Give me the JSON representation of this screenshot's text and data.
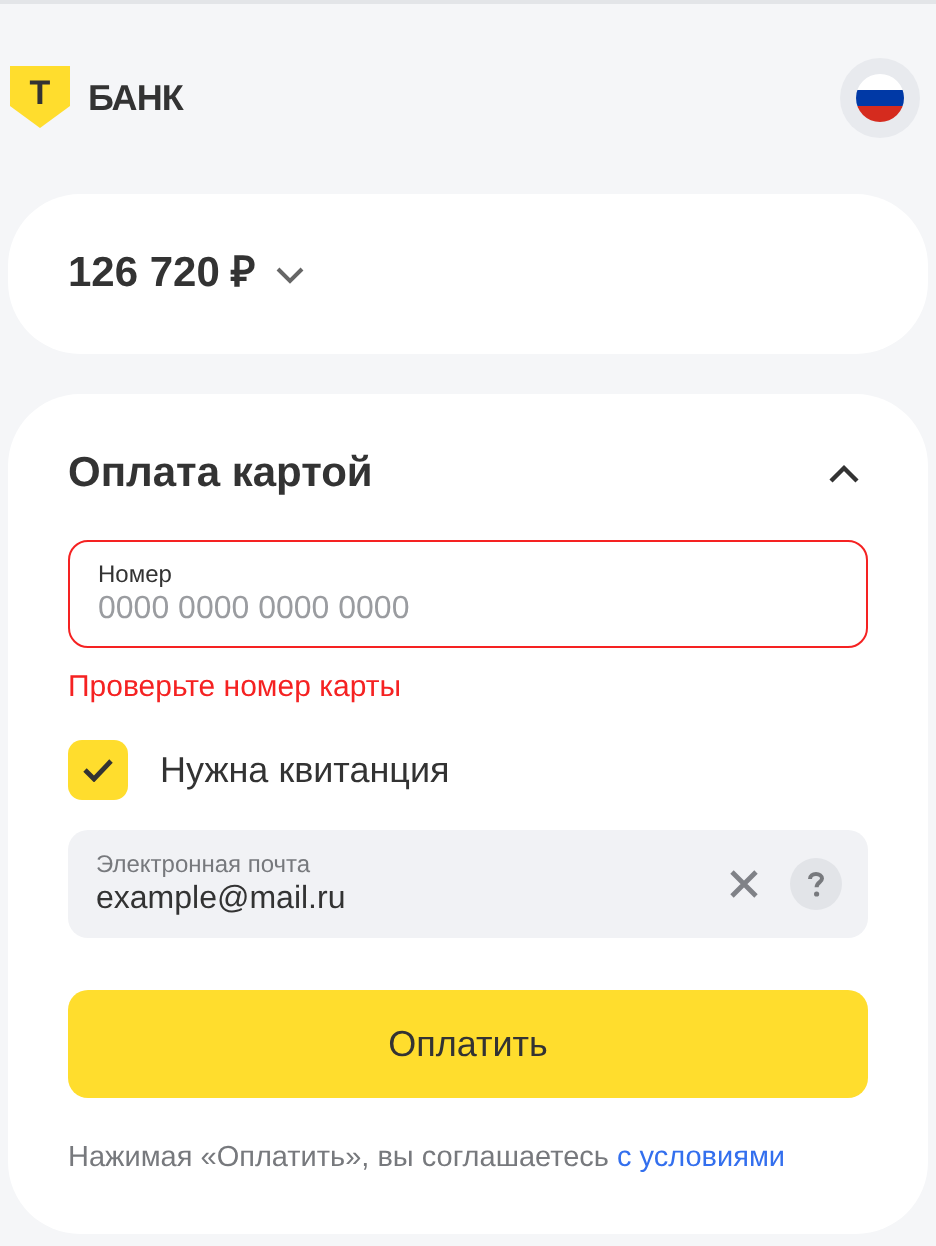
{
  "logo": {
    "mark": "Т",
    "name": "БАНК"
  },
  "amount": {
    "value": "126 720 ₽",
    "expanded": false
  },
  "payment": {
    "title": "Оплата картой",
    "expanded": true,
    "card_field": {
      "label": "Номер",
      "placeholder": "0000 0000 0000 0000",
      "error": true,
      "error_text": "Проверьте номер карты"
    },
    "receipt": {
      "label": "Нужна квитанция",
      "checked": true
    },
    "email_field": {
      "label": "Электронная почта",
      "value": "example@mail.ru"
    },
    "pay_button": "Оплатить",
    "terms": {
      "text": "Нажимая «Оплатить», вы соглашаетесь",
      "link": "с условиями"
    }
  }
}
